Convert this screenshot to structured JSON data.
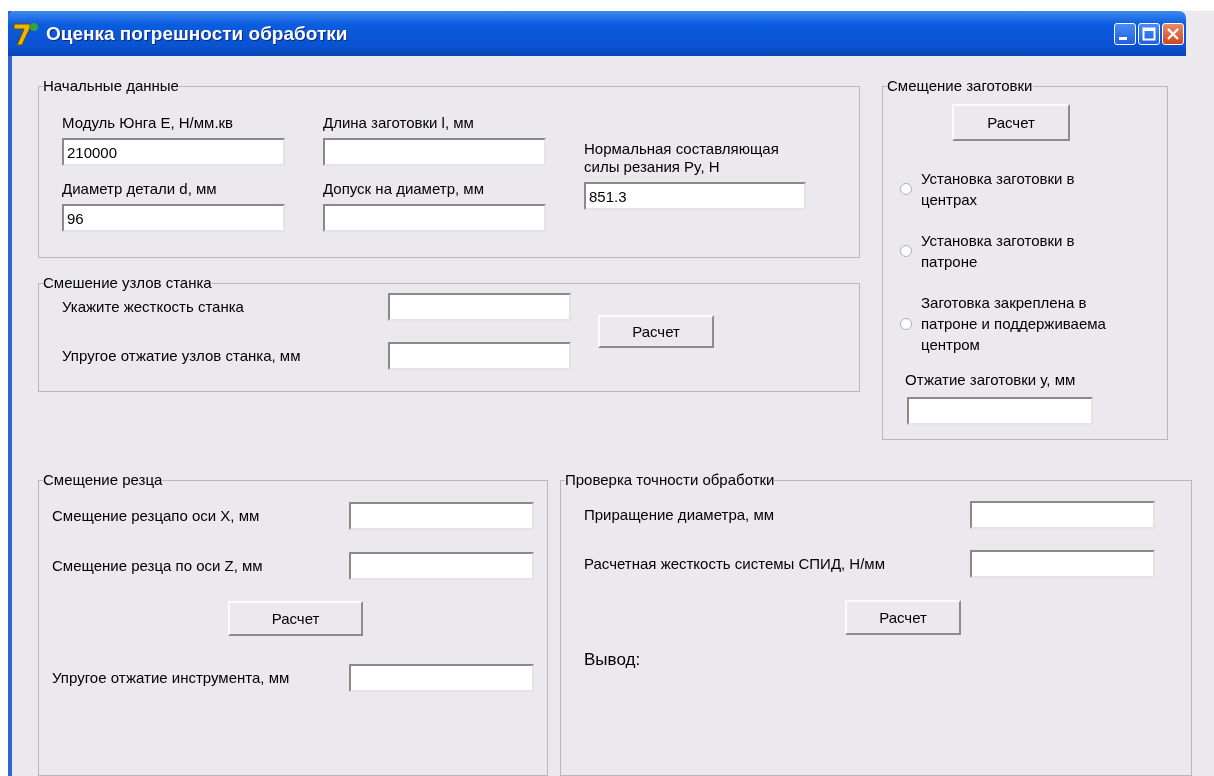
{
  "window": {
    "title": "Оценка погрешности обработки"
  },
  "initial_data": {
    "legend": "Начальные данные",
    "columns": [
      [
        {
          "label": "Модуль Юнга Е, Н/мм.кв",
          "value": "210000"
        },
        {
          "label": "Диаметр детали d, мм",
          "value": "96"
        }
      ],
      [
        {
          "label": "Длина заготовки l, мм"
        },
        {
          "label": "Допуск на диаметр, мм"
        }
      ],
      [
        {
          "label": "Нормальная составляющая силы резания Py, Н",
          "value": "851.3"
        }
      ]
    ]
  },
  "machine_nodes": {
    "legend": "Смешение узлов станка",
    "fields": [
      {
        "label": "Укажите жесткость станка"
      },
      {
        "label": "Упругое отжатие узлов станка, мм"
      }
    ],
    "button": "Расчет"
  },
  "workpiece": {
    "legend": "Смещение заготовки",
    "button": "Расчет",
    "options": [
      {
        "label": "Установка заготовки в центрах",
        "selected": false
      },
      {
        "label": "Установка заготовки в патроне",
        "selected": false
      },
      {
        "label": "Заготовка закреплена в патроне и поддерживаема центром",
        "selected": false
      }
    ],
    "result": {
      "label": "Отжатие заготовки у, мм"
    }
  },
  "cutter": {
    "legend": "Смещение резца",
    "fields": [
      {
        "label": "Смещение резцапо оси X, мм"
      },
      {
        "label": "Смещение резца по оси Z, мм"
      }
    ],
    "button": "Расчет",
    "result": {
      "label": "Упругое отжатие инструмента, мм"
    }
  },
  "accuracy": {
    "legend": "Проверка точности обработки",
    "fields": [
      {
        "label": "Приращение диаметра, мм"
      },
      {
        "label": "Расчетная жесткость системы СПИД, Н/мм"
      }
    ],
    "button": "Расчет",
    "conclusion": "Вывод:"
  }
}
